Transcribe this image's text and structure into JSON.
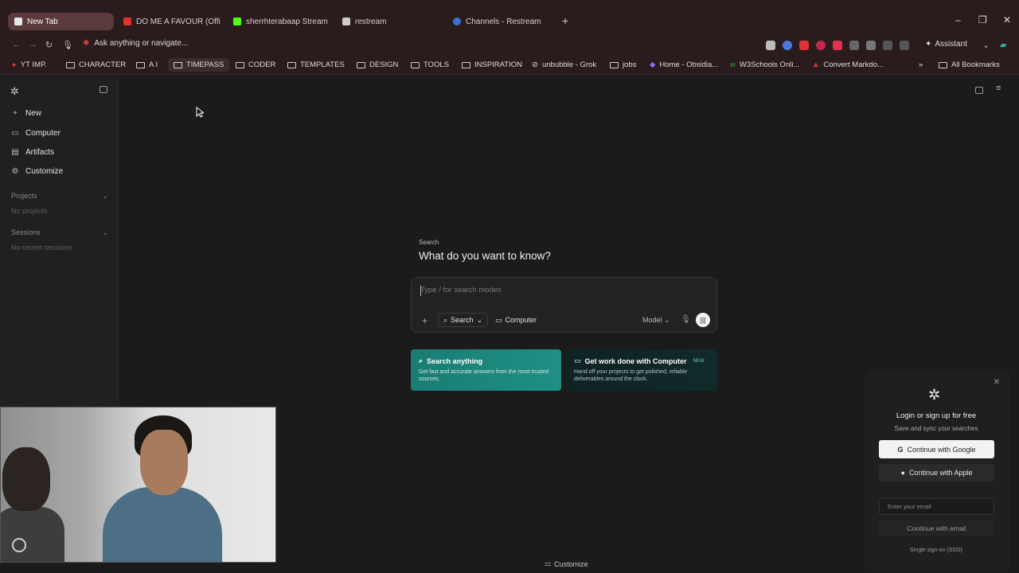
{
  "tabs": [
    {
      "label": "New Tab",
      "active": true,
      "fav": "#e6e6e6"
    },
    {
      "label": "DO ME A FAVOUR (Officia",
      "active": false,
      "fav": "#e03030"
    },
    {
      "label": "sherrhterabaap Stream - V",
      "active": false,
      "fav": "#53fc18"
    },
    {
      "label": "restream",
      "active": false,
      "fav": "#cccccc"
    },
    {
      "label": "Channels - Restream",
      "active": false,
      "fav": "#3c6fd8"
    }
  ],
  "omnibox": {
    "placeholder": "Ask anything or navigate..."
  },
  "assistant_label": "Assistant",
  "bookmarks": [
    "YT IMP.",
    "CHARACTER",
    "A I",
    "TIMEPASS",
    "CODER",
    "TEMPLATES",
    "DESIGN",
    "TOOLS",
    "INSPIRATION",
    "unbubble - Grok",
    "jobs",
    "Home - Obsidia...",
    "W3Schools Onli...",
    "Convert Markdo...",
    "All Bookmarks"
  ],
  "sidebar": {
    "items": [
      "New",
      "Computer",
      "Artifacts",
      "Customize"
    ],
    "projects_label": "Projects",
    "projects_empty": "No projects",
    "sessions_label": "Sessions",
    "sessions_empty": "No recent sessions"
  },
  "main": {
    "kicker": "Search",
    "headline": "What do you want to know?",
    "composer_placeholder": "Type / for search modes",
    "search_mode": "Search",
    "computer_mode": "Computer",
    "model_label": "Model"
  },
  "cards": {
    "search_title": "Search anything",
    "search_desc": "Get fast and accurate answers from the most trusted sources.",
    "computer_title": "Get work done with Computer",
    "computer_badge": "NEW",
    "computer_desc": "Hand off your projects to get polished, reliable deliverables around the clock."
  },
  "bottom_customize": "Customize",
  "login": {
    "title": "Login or sign up for free",
    "subtitle": "Save and sync your searches",
    "google": "Continue with Google",
    "apple": "Continue with Apple",
    "email_placeholder": "Enter your email",
    "email_button": "Continue with email",
    "sso": "Single sign-on (SSO)"
  }
}
